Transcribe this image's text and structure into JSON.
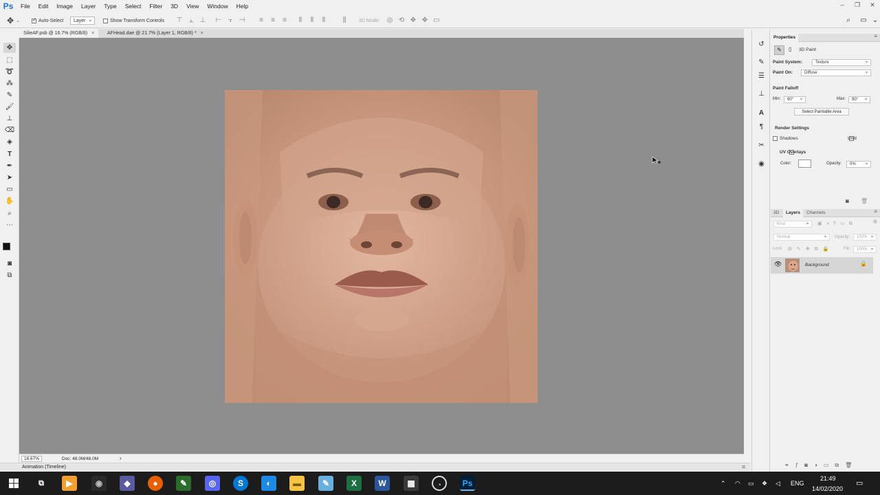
{
  "app": {
    "logo": "Ps"
  },
  "menu": [
    "File",
    "Edit",
    "Image",
    "Layer",
    "Type",
    "Select",
    "Filter",
    "3D",
    "View",
    "Window",
    "Help"
  ],
  "window_controls": {
    "minimize": "–",
    "restore": "❐",
    "close": "✕"
  },
  "options": {
    "auto_select_label": "Auto-Select",
    "auto_select_checked": true,
    "auto_select_target": "Layer",
    "show_transform_label": "Show Transform Controls",
    "mode_3d_label": "3D Mode:"
  },
  "tabs": [
    {
      "label": "SilieAF.psb @ 16.7% (RGB/8)",
      "close": "×"
    },
    {
      "label": "AFHead.dae @ 21.7% (Layer 1, RGB/8) *",
      "close": "×"
    }
  ],
  "status": {
    "zoom": "16.67%",
    "doc": "Doc: 48.0M/48.0M",
    "arrow": "›"
  },
  "timeline": {
    "label": "Animation (Timeline)"
  },
  "properties": {
    "tab": "Properties",
    "title": "3D Paint",
    "paint_system_label": "Paint System:",
    "paint_system_value": "Texture",
    "paint_on_label": "Paint On:",
    "paint_on_value": "Diffuse",
    "falloff_label": "Paint Falloff",
    "min_label": "Min:",
    "min_value": "90°",
    "max_label": "Max:",
    "max_value": "90°",
    "select_paintable_label": "Select Paintable Area",
    "render_settings_label": "Render Settings",
    "shadows_label": "Shadows",
    "unlit_label": "Unlit",
    "uv_overlays_label": "UV Overlays",
    "color_label": "Color:",
    "opacity_label": "Opacity:",
    "opacity_value": "0%"
  },
  "layers_panel": {
    "tabs": [
      "3D",
      "Layers",
      "Channels"
    ],
    "active_tab": "Layers",
    "kind_placeholder": "Kind",
    "blend_mode": "Normal",
    "opacity_label": "Opacity:",
    "opacity_value": "100%",
    "lock_label": "Lock:",
    "fill_label": "Fill:",
    "fill_value": "100%",
    "layers": [
      {
        "name": "Background"
      }
    ]
  },
  "taskbar": {
    "lang": "ENG",
    "time": "21:49",
    "date": "14/02/2020"
  },
  "colors": {
    "canvas_bg": "#8e8e8e",
    "skin": "#c9987e",
    "accent": "#1c6fd0"
  }
}
